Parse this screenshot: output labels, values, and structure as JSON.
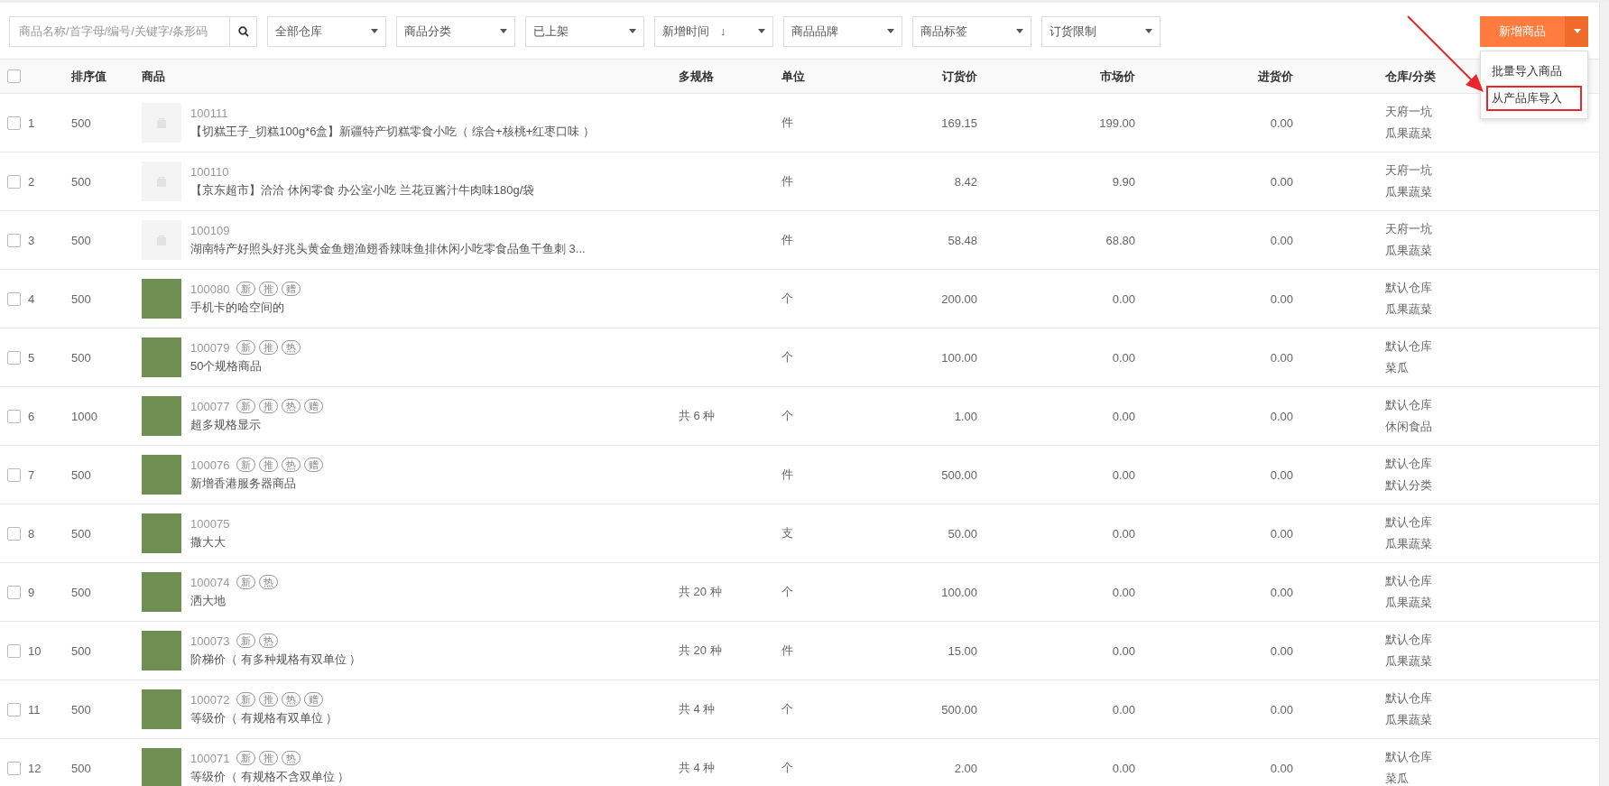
{
  "toolbar": {
    "search": {
      "placeholder": "商品名称/首字母/编号/关键字/条形码"
    },
    "filters": [
      {
        "label": "全部仓库"
      },
      {
        "label": "商品分类"
      },
      {
        "label": "已上架"
      },
      {
        "label": "新增时间",
        "sort": "↓"
      },
      {
        "label": "商品品牌"
      },
      {
        "label": "商品标签"
      },
      {
        "label": "订货限制"
      }
    ],
    "add_button": {
      "label": "新增商品",
      "expanded": true
    },
    "menu": [
      {
        "label": "批量导入商品",
        "highlighted": false
      },
      {
        "label": "从产品库导入",
        "highlighted": true
      }
    ]
  },
  "table": {
    "select_all": {
      "checked": false
    },
    "columns": [
      "排序值",
      "商品",
      "多规格",
      "单位",
      "订货价",
      "市场价",
      "进货价",
      "仓库/分类"
    ],
    "rows": [
      {
        "checked": false,
        "index": "1",
        "sort": "500",
        "kind": "placeholder",
        "code": "100111",
        "tags": [],
        "name": "【切糕王子_切糕100g*6盒】新疆特产切糕零食小吃（ 综合+核桃+红枣口味 ）",
        "specs": "",
        "unit": "件",
        "order_price": "169.15",
        "market_price": "199.00",
        "cost_price": "0.00",
        "warehouse": "天府一坑",
        "category": "瓜果蔬菜"
      },
      {
        "checked": false,
        "index": "2",
        "sort": "500",
        "kind": "placeholder",
        "code": "100110",
        "tags": [],
        "name": "【京东超市】洽洽 休闲零食 办公室小吃 兰花豆酱汁牛肉味180g/袋",
        "specs": "",
        "unit": "件",
        "order_price": "8.42",
        "market_price": "9.90",
        "cost_price": "0.00",
        "warehouse": "天府一坑",
        "category": "瓜果蔬菜"
      },
      {
        "checked": false,
        "index": "3",
        "sort": "500",
        "kind": "placeholder",
        "code": "100109",
        "tags": [],
        "name": "湖南特产好照头好兆头黄金鱼翅渔翅香辣味鱼排休闲小吃零食品鱼干鱼刺 3...",
        "specs": "",
        "unit": "件",
        "order_price": "58.48",
        "market_price": "68.80",
        "cost_price": "0.00",
        "warehouse": "天府一坑",
        "category": "瓜果蔬菜"
      },
      {
        "checked": false,
        "index": "4",
        "sort": "500",
        "kind": "photo",
        "code": "100080",
        "tags": [
          "新",
          "推",
          "赠"
        ],
        "name": "手机卡的哈空间的",
        "specs": "",
        "unit": "个",
        "order_price": "200.00",
        "market_price": "0.00",
        "cost_price": "0.00",
        "warehouse": "默认仓库",
        "category": "瓜果蔬菜"
      },
      {
        "checked": false,
        "index": "5",
        "sort": "500",
        "kind": "photo",
        "code": "100079",
        "tags": [
          "新",
          "推",
          "热"
        ],
        "name": "50个规格商品",
        "specs": "",
        "unit": "个",
        "order_price": "100.00",
        "market_price": "0.00",
        "cost_price": "0.00",
        "warehouse": "默认仓库",
        "category": "菜瓜"
      },
      {
        "checked": false,
        "index": "6",
        "sort": "1000",
        "kind": "photo",
        "code": "100077",
        "tags": [
          "新",
          "推",
          "热",
          "赠"
        ],
        "name": "超多规格显示",
        "specs": "共 6 种",
        "unit": "个",
        "order_price": "1.00",
        "market_price": "0.00",
        "cost_price": "0.00",
        "warehouse": "默认仓库",
        "category": "休闲食品"
      },
      {
        "checked": false,
        "index": "7",
        "sort": "500",
        "kind": "photo",
        "code": "100076",
        "tags": [
          "新",
          "推",
          "热",
          "赠"
        ],
        "name": "新增香港服务器商品",
        "specs": "",
        "unit": "件",
        "order_price": "500.00",
        "market_price": "0.00",
        "cost_price": "0.00",
        "warehouse": "默认仓库",
        "category": "默认分类"
      },
      {
        "checked": false,
        "index": "8",
        "sort": "500",
        "kind": "photo",
        "code": "100075",
        "tags": [],
        "name": "撒大大",
        "specs": "",
        "unit": "支",
        "order_price": "50.00",
        "market_price": "0.00",
        "cost_price": "0.00",
        "warehouse": "默认仓库",
        "category": "瓜果蔬菜"
      },
      {
        "checked": false,
        "index": "9",
        "sort": "500",
        "kind": "photo",
        "code": "100074",
        "tags": [
          "新",
          "热"
        ],
        "name": "洒大地",
        "specs": "共 20 种",
        "unit": "个",
        "order_price": "100.00",
        "market_price": "0.00",
        "cost_price": "0.00",
        "warehouse": "默认仓库",
        "category": "瓜果蔬菜"
      },
      {
        "checked": false,
        "index": "10",
        "sort": "500",
        "kind": "photo",
        "code": "100073",
        "tags": [
          "新",
          "热"
        ],
        "name": "阶梯价（ 有多种规格有双单位 ）",
        "specs": "共 20 种",
        "unit": "件",
        "order_price": "15.00",
        "market_price": "0.00",
        "cost_price": "0.00",
        "warehouse": "默认仓库",
        "category": "瓜果蔬菜"
      },
      {
        "checked": false,
        "index": "11",
        "sort": "500",
        "kind": "photo",
        "code": "100072",
        "tags": [
          "新",
          "推",
          "热",
          "赠"
        ],
        "name": "等级价（ 有规格有双单位 ）",
        "specs": "共 4 种",
        "unit": "个",
        "order_price": "500.00",
        "market_price": "0.00",
        "cost_price": "0.00",
        "warehouse": "默认仓库",
        "category": "瓜果蔬菜"
      },
      {
        "checked": false,
        "index": "12",
        "sort": "500",
        "kind": "photo",
        "code": "100071",
        "tags": [
          "新",
          "推",
          "热"
        ],
        "name": "等级价（ 有规格不含双单位 ）",
        "specs": "共 4 种",
        "unit": "个",
        "order_price": "2.00",
        "market_price": "0.00",
        "cost_price": "0.00",
        "warehouse": "默认仓库",
        "category": "菜瓜"
      }
    ]
  }
}
